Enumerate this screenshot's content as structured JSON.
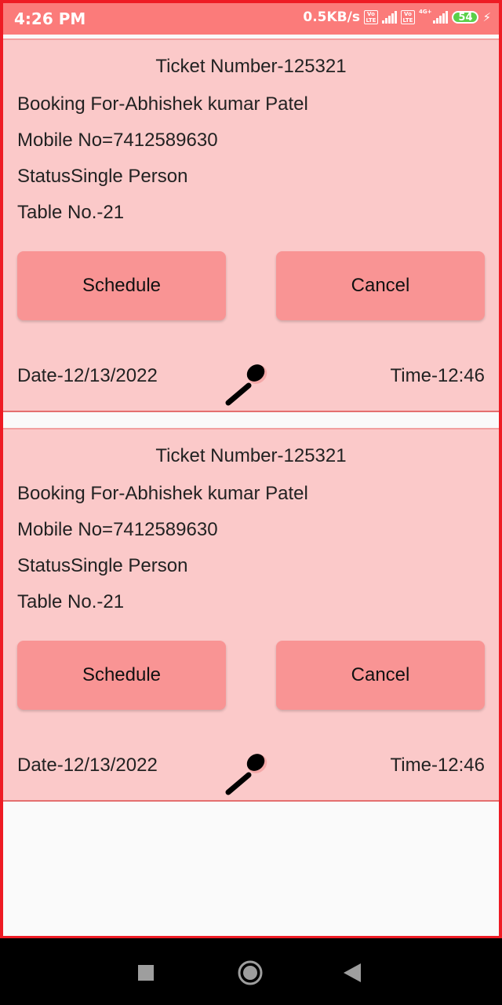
{
  "status_bar": {
    "time": "4:26 PM",
    "network_speed": "0.5KB/s",
    "volte_label_1": "Vo LTE",
    "volte_label_2": "Vo LTE",
    "network_type": "4G+",
    "battery_level": "54"
  },
  "bookings": [
    {
      "ticket_number": "Ticket Number-125321",
      "booking_for": "Booking For-Abhishek kumar Patel",
      "mobile": "Mobile No=7412589630",
      "status": "StatusSingle Person",
      "table": "Table No.-21",
      "schedule_label": "Schedule",
      "cancel_label": "Cancel",
      "date": "Date-12/13/2022",
      "time": "Time-12:46",
      "icon": "spoon-icon"
    },
    {
      "ticket_number": "Ticket Number-125321",
      "booking_for": "Booking For-Abhishek kumar Patel",
      "mobile": "Mobile No=7412589630",
      "status": "StatusSingle Person",
      "table": "Table No.-21",
      "schedule_label": "Schedule",
      "cancel_label": "Cancel",
      "date": "Date-12/13/2022",
      "time": "Time-12:46",
      "icon": "spoon-icon"
    }
  ],
  "colors": {
    "status_bar": "#fb7b7a",
    "card_background": "#fbc9c9",
    "button_background": "#f99494",
    "frame_border": "#ee1b24"
  },
  "navigation": {
    "recent_icon": "square-icon",
    "home_icon": "circle-icon",
    "back_icon": "triangle-back-icon"
  }
}
